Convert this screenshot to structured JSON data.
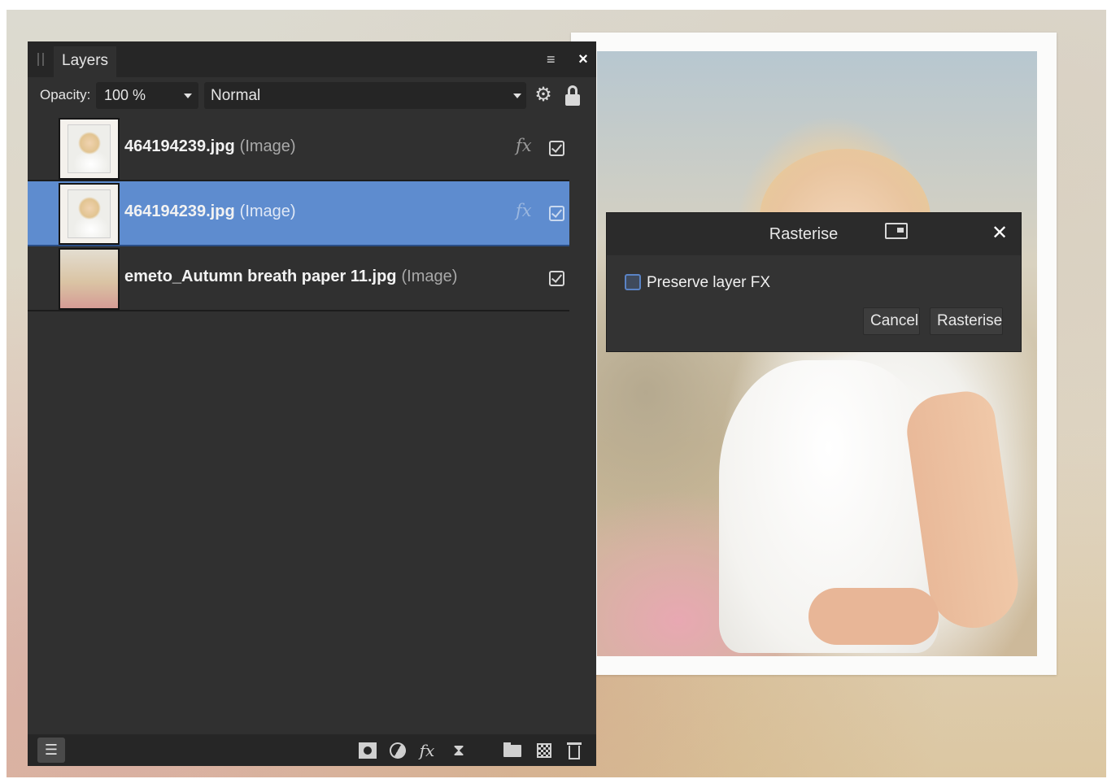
{
  "layers_panel": {
    "tab_label": "Layers",
    "menu_icon": "hamburger-menu-icon",
    "close_icon": "close-icon",
    "close_glyph": "×",
    "opacity_label": "Opacity:",
    "opacity_value": "100 %",
    "blend_mode": "Normal",
    "settings_icon": "gear-icon",
    "lock_icon": "lock-icon",
    "layers": [
      {
        "name": "464194239.jpg",
        "type": "(Image)",
        "fx": "fx",
        "visible": true,
        "selected": false,
        "thumb": "photo"
      },
      {
        "name": "464194239.jpg",
        "type": "(Image)",
        "fx": "fx",
        "visible": true,
        "selected": true,
        "thumb": "photo"
      },
      {
        "name": "emeto_Autumn breath paper 11.jpg",
        "type": "(Image)",
        "fx": "",
        "visible": true,
        "selected": false,
        "thumb": "paper"
      }
    ],
    "footer_icons": [
      "layers-stack-icon",
      "mask-icon",
      "adjustment-icon",
      "fx-icon",
      "hourglass-icon",
      "folder-icon",
      "pixel-layer-icon",
      "trash-icon"
    ],
    "footer_fx_label": "fx"
  },
  "rasterise_dialog": {
    "title": "Rasterise",
    "close_glyph": "✕",
    "preserve_fx_label": "Preserve layer FX",
    "preserve_fx_checked": false,
    "cancel_label": "Cancel",
    "rasterise_label": "Rasterise"
  },
  "colors": {
    "panel_bg": "#303030",
    "selected_row": "#5e8ccf",
    "dialog_bg": "#333333"
  }
}
